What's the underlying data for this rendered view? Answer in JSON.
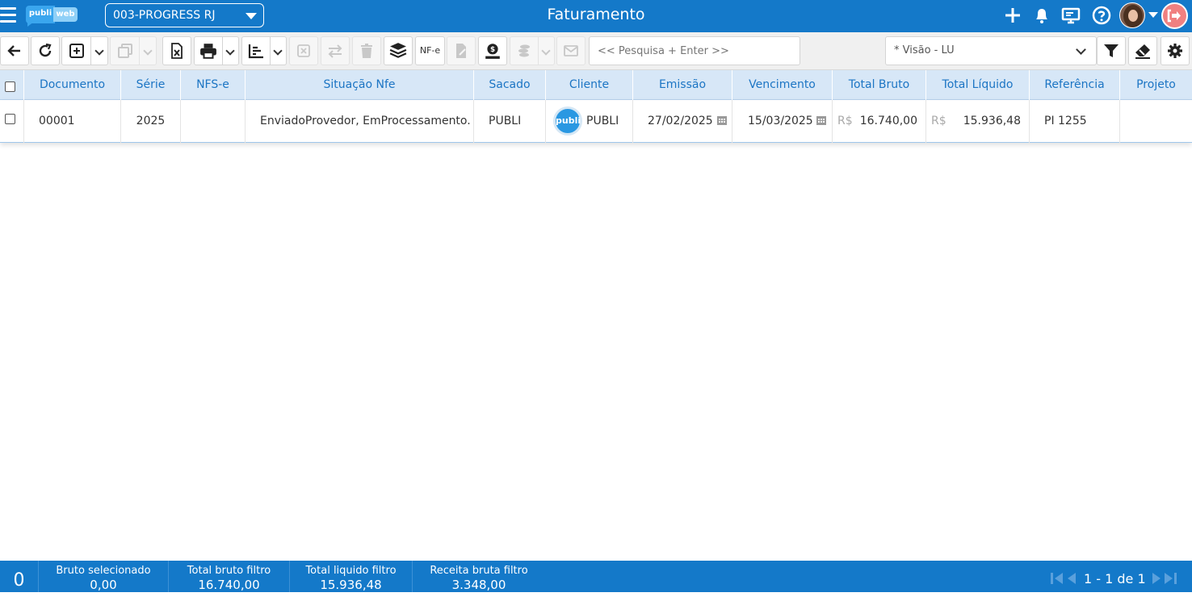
{
  "topbar": {
    "company": "003-PROGRESS RJ",
    "title": "Faturamento",
    "logo_part1": "publi",
    "logo_part2": "web"
  },
  "toolbar": {
    "nfe_label": "NF-e",
    "search_placeholder": "<< Pesquisa + Enter >>",
    "vision": "* Visão - LU"
  },
  "grid": {
    "columns": [
      "Documento",
      "Série",
      "NFS-e",
      "Situação Nfe",
      "Sacado",
      "Cliente",
      "Emissão",
      "Vencimento",
      "Total Bruto",
      "Total Líquido",
      "Referência",
      "Projeto"
    ],
    "rows": [
      {
        "documento": "00001",
        "serie": "2025",
        "nfse": "",
        "situacao": "EnviadoProvedor, EmProcessamento.",
        "sacado": "PUBLI",
        "cliente_logo": "publi",
        "cliente": "PUBLI",
        "emissao": "27/02/2025",
        "vencimento": "15/03/2025",
        "currency": "R$",
        "total_bruto": "16.740,00",
        "total_liquido": "15.936,48",
        "referencia": "PI 1255",
        "projeto": ""
      }
    ]
  },
  "footer": {
    "selected_count": "0",
    "stats": [
      {
        "label": "Bruto selecionado",
        "value": "0,00"
      },
      {
        "label": "Total bruto filtro",
        "value": "16.740,00"
      },
      {
        "label": "Total liquido filtro",
        "value": "15.936,48"
      },
      {
        "label": "Receita bruta filtro",
        "value": "3.348,00"
      }
    ],
    "pagination": "1 - 1 de 1"
  },
  "colors": {
    "primary": "#1479c9",
    "header_bg": "#d7e7f7",
    "header_text": "#1c75c4",
    "logout": "#f08080"
  }
}
